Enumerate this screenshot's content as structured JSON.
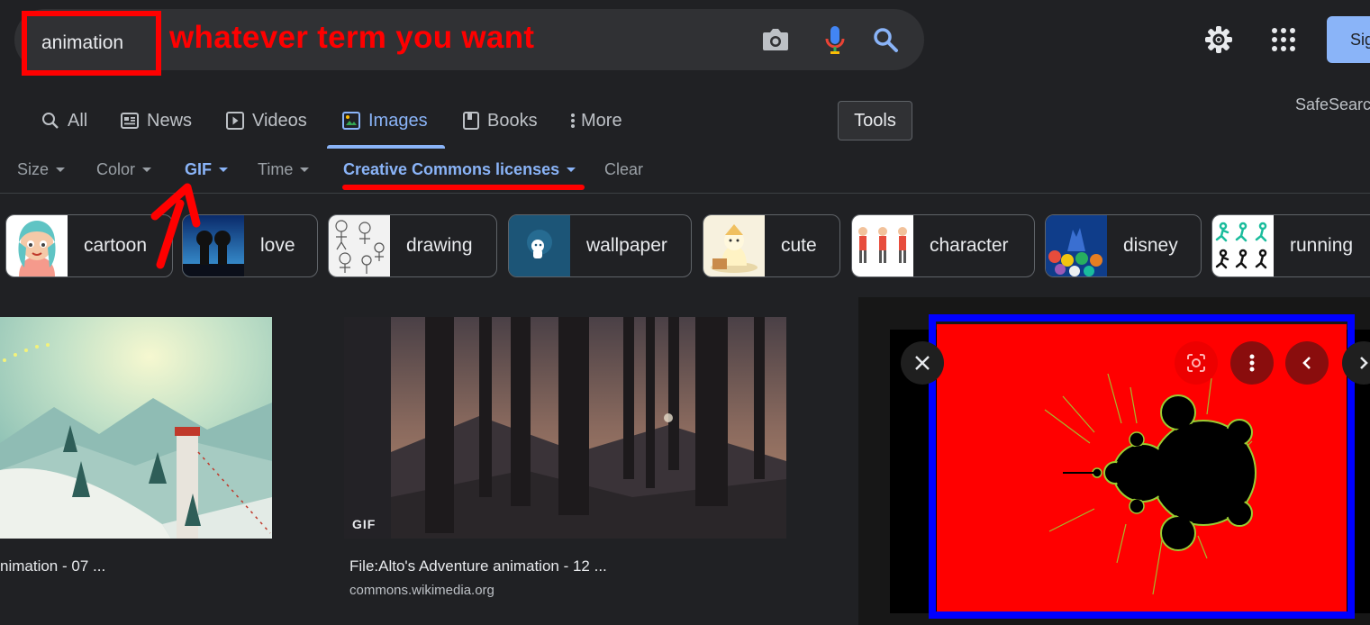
{
  "search": {
    "query": "animation",
    "annotation": "whatever term you want"
  },
  "header": {
    "sign_in_label": "Sig"
  },
  "tabs": [
    {
      "label": "All",
      "icon": "search-icon"
    },
    {
      "label": "News",
      "icon": "news-icon"
    },
    {
      "label": "Videos",
      "icon": "video-icon"
    },
    {
      "label": "Images",
      "icon": "image-icon",
      "active": true
    },
    {
      "label": "Books",
      "icon": "book-icon"
    },
    {
      "label": "More",
      "icon": "more-vert-icon"
    }
  ],
  "tools_label": "Tools",
  "safesearch_label": "SafeSearc",
  "filters": [
    {
      "label": "Size"
    },
    {
      "label": "Color"
    },
    {
      "label": "GIF",
      "active": true
    },
    {
      "label": "Time"
    },
    {
      "label": "Creative Commons licenses",
      "active": true
    },
    {
      "label": "Clear"
    }
  ],
  "chips": [
    {
      "label": "cartoon"
    },
    {
      "label": "love"
    },
    {
      "label": "drawing"
    },
    {
      "label": "wallpaper"
    },
    {
      "label": "cute"
    },
    {
      "label": "character"
    },
    {
      "label": "disney"
    },
    {
      "label": "running"
    }
  ],
  "results": [
    {
      "title": "nimation - 07 ..."
    },
    {
      "title": "File:Alto's Adventure animation - 12 ...",
      "source": "commons.wikimedia.org",
      "badge": "GIF"
    }
  ],
  "colors": {
    "accent": "#8ab4f8",
    "annotation_red": "#ff0000",
    "annotation_blue": "#0000ff",
    "background": "#202124"
  }
}
